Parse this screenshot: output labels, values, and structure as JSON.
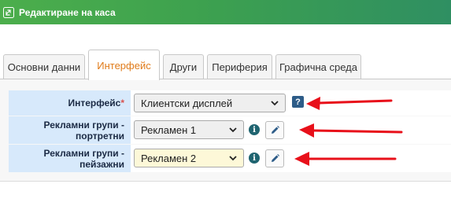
{
  "window": {
    "title": "Редактиране на каса",
    "icon": "link-icon",
    "colors": {
      "titlebar_start": "#4cae4c",
      "titlebar_end": "#2f8f62"
    }
  },
  "tabs": [
    {
      "label": "Основни данни",
      "active": false
    },
    {
      "label": "Интерфейс",
      "active": true
    },
    {
      "label": "Други",
      "active": false
    },
    {
      "label": "Периферия",
      "active": false
    },
    {
      "label": "Графична среда",
      "active": false
    }
  ],
  "form": {
    "interface": {
      "label": "Интерфейс",
      "required_mark": "*",
      "value": "Клиентски дисплей",
      "help_icon": "help-icon",
      "help_glyph": "?"
    },
    "ads_portrait": {
      "label_line1": "Рекламни групи -",
      "label_line2": "портретни",
      "value": "Рекламен 1",
      "info_glyph": "i"
    },
    "ads_landscape": {
      "label_line1": "Рекламни групи -",
      "label_line2": "пейзажни",
      "value": "Рекламен 2",
      "info_glyph": "i"
    }
  },
  "annotations": {
    "arrow_color": "#e8101a"
  }
}
